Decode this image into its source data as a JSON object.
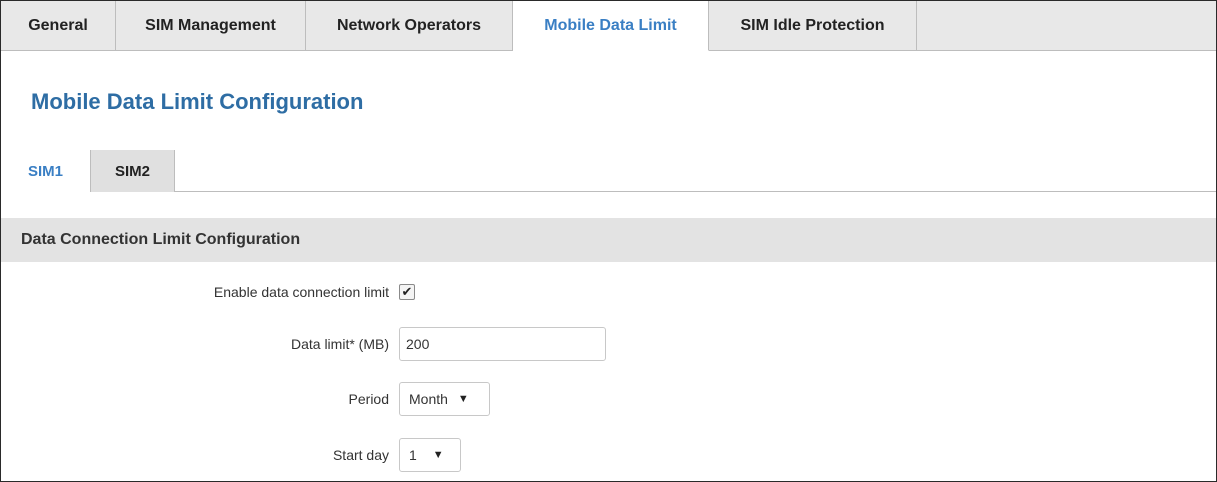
{
  "top_tabs": [
    {
      "label": "General",
      "active": false
    },
    {
      "label": "SIM Management",
      "active": false
    },
    {
      "label": "Network Operators",
      "active": false
    },
    {
      "label": "Mobile Data Limit",
      "active": true
    },
    {
      "label": "SIM Idle Protection",
      "active": false
    }
  ],
  "page_title": "Mobile Data Limit Configuration",
  "sim_tabs": [
    {
      "label": "SIM1",
      "active": true
    },
    {
      "label": "SIM2",
      "active": false
    }
  ],
  "section": {
    "title": "Data Connection Limit Configuration"
  },
  "form": {
    "enable_label": "Enable data connection limit",
    "enable_checked": true,
    "enable_check_glyph": "✔",
    "data_limit_label": "Data limit* (MB)",
    "data_limit_value": "200",
    "period_label": "Period",
    "period_value": "Month",
    "start_day_label": "Start day",
    "start_day_value": "1",
    "select_arrow": "▼"
  },
  "colors": {
    "accent": "#3a7fc4",
    "title": "#2e6da4",
    "tab_bg": "#e8e8e8",
    "section_bg": "#e3e3e3"
  }
}
